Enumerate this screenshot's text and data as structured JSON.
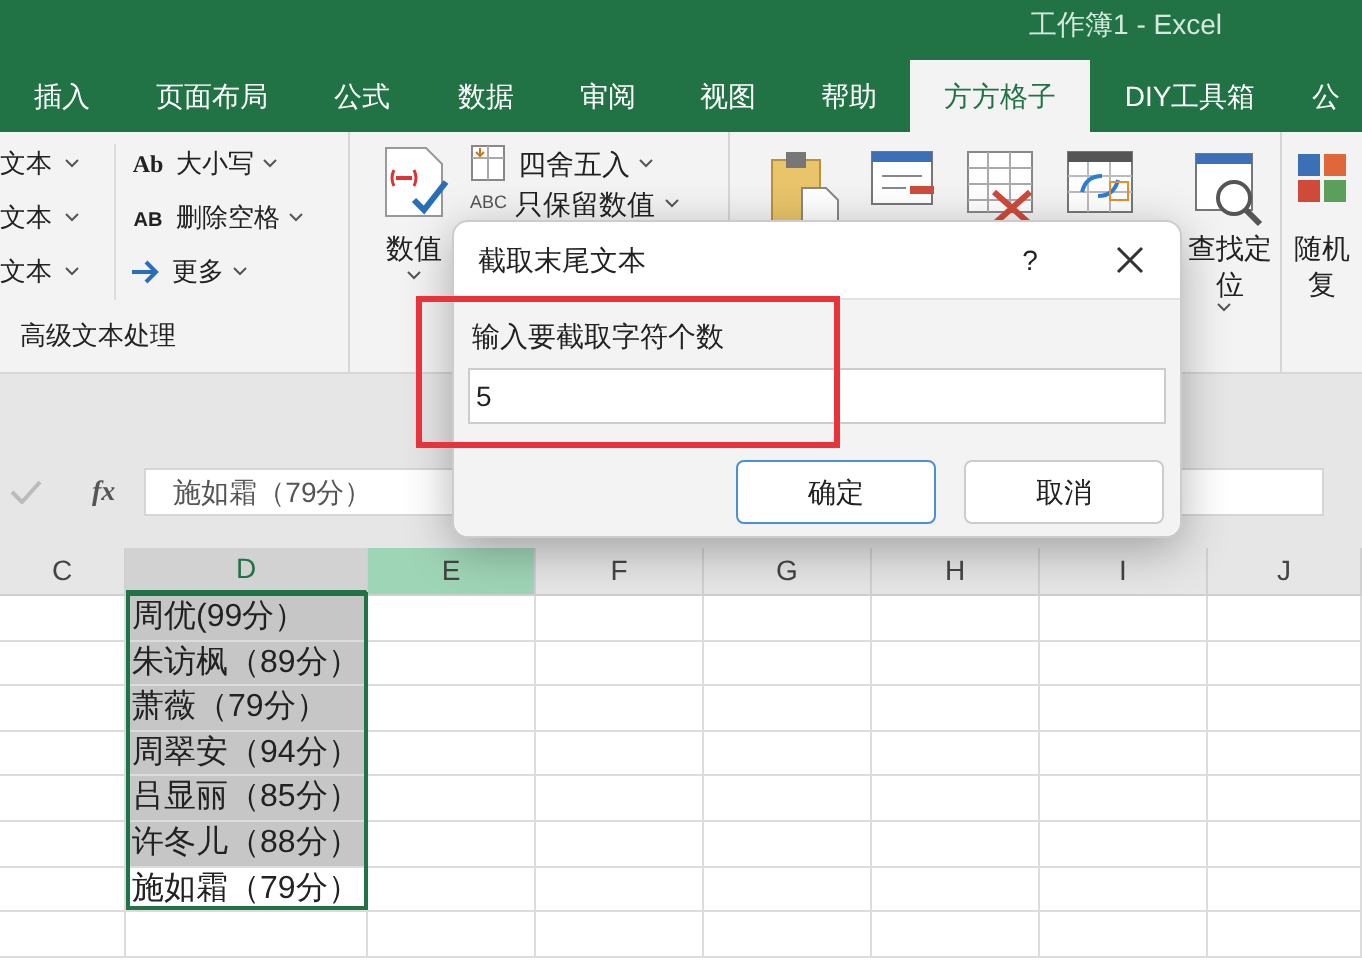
{
  "title_bar": {
    "title": "工作簿1  -  Excel"
  },
  "tabs": [
    {
      "label": "插入",
      "selected": false
    },
    {
      "label": "页面布局",
      "selected": false
    },
    {
      "label": "公式",
      "selected": false
    },
    {
      "label": "数据",
      "selected": false
    },
    {
      "label": "审阅",
      "selected": false
    },
    {
      "label": "视图",
      "selected": false
    },
    {
      "label": "帮助",
      "selected": false
    },
    {
      "label": "方方格子",
      "selected": true
    },
    {
      "label": "DIY工具箱",
      "selected": false
    },
    {
      "label": "公",
      "selected": false
    }
  ],
  "ribbon": {
    "text_menus": [
      "文本",
      "文本",
      "文本"
    ],
    "text_tools": [
      {
        "kind": "case",
        "badge": "Ab",
        "label": "大小写"
      },
      {
        "kind": "delete",
        "badge": "AB",
        "label": "删除空格"
      },
      {
        "kind": "more",
        "label": "更多"
      }
    ],
    "group_label": "高级文本处理",
    "number_button": {
      "label": "数值"
    },
    "number_tools": [
      {
        "kind": "round",
        "label": "四舍五入"
      },
      {
        "kind": "keep",
        "badge": "ABC",
        "label": "只保留数值"
      }
    ],
    "find_button": {
      "lines": [
        "查找定",
        "位"
      ]
    },
    "random_button": {
      "lines": [
        "随机",
        "复"
      ]
    }
  },
  "formula_bar": {
    "function_label": "fx",
    "value": "施如霜（79分）"
  },
  "columns": [
    {
      "label": "C",
      "selected": false,
      "hover": false
    },
    {
      "label": "D",
      "selected": true,
      "hover": false
    },
    {
      "label": "E",
      "selected": false,
      "hover": true
    },
    {
      "label": "F",
      "selected": false,
      "hover": false
    },
    {
      "label": "G",
      "selected": false,
      "hover": false
    },
    {
      "label": "H",
      "selected": false,
      "hover": false
    },
    {
      "label": "I",
      "selected": false,
      "hover": false
    },
    {
      "label": "J",
      "selected": false,
      "hover": false
    }
  ],
  "cells": [
    {
      "value": "周优(99分）",
      "active": false
    },
    {
      "value": "朱访枫（89分）",
      "active": false
    },
    {
      "value": "萧薇（79分）",
      "active": false
    },
    {
      "value": "周翠安（94分）",
      "active": false
    },
    {
      "value": "吕显丽（85分）",
      "active": false
    },
    {
      "value": "许冬儿（88分）",
      "active": false
    },
    {
      "value": "施如霜（79分）",
      "active": true
    }
  ],
  "dialog": {
    "title": "截取末尾文本",
    "help": "?",
    "label": "输入要截取字符个数",
    "value": "5",
    "highlighted": true,
    "buttons": [
      {
        "label": "确定",
        "default": true
      },
      {
        "label": "取消",
        "default": false
      }
    ]
  }
}
